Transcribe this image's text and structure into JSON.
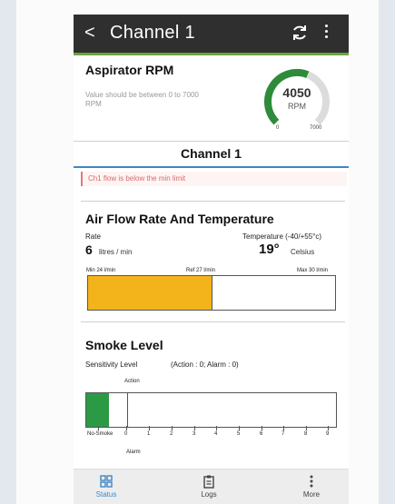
{
  "header": {
    "back_symbol": "<",
    "title": "Channel 1",
    "refresh_icon": "refresh-icon",
    "menu_icon": "more-vert-icon"
  },
  "rpm": {
    "title": "Aspirator RPM",
    "hint": "Value should be between 0 to 7000 RPM",
    "value": "4050",
    "unit": "RPM",
    "min": "0",
    "max": "7000",
    "gauge_fraction": 0.58,
    "gauge_color": "#2e8b3a"
  },
  "channel": {
    "title": "Channel 1",
    "alert": "Ch1 flow is below the min limit",
    "alert_color": "#d96a6a"
  },
  "airflow": {
    "title": "Air Flow Rate And Temperature",
    "rate_label": "Rate",
    "temp_label": "Temperature (-40/+55°c)",
    "rate_value": "6",
    "rate_unit": "litres / min",
    "temp_value": "19°",
    "temp_unit": "Celsius",
    "scale_min": "Min 24 l/min",
    "scale_ref": "Ref 27 l/min",
    "scale_max": "Max 30 l/min",
    "bar_fill_fraction": 0.5,
    "bar_color": "#f3b41b"
  },
  "smoke": {
    "title": "Smoke Level",
    "sensitivity_label": "Sensitivity Level",
    "sensitivity_value": "(Action : 0; Alarm : 0)",
    "action_label": "Action",
    "alarm_label": "Alarm",
    "scale_labels": [
      "No-Smoke",
      "0",
      "1",
      "2",
      "3",
      "4",
      "5",
      "6",
      "7",
      "8",
      "9"
    ],
    "bar_fill_fraction": 0.09,
    "bar_color": "#2c9a45"
  },
  "nav": {
    "items": [
      {
        "label": "Status",
        "icon": "grid-icon",
        "active": true
      },
      {
        "label": "Logs",
        "icon": "clipboard-icon",
        "active": false
      },
      {
        "label": "More",
        "icon": "more-vert-icon",
        "active": false
      }
    ],
    "active_color": "#3f86c8"
  }
}
